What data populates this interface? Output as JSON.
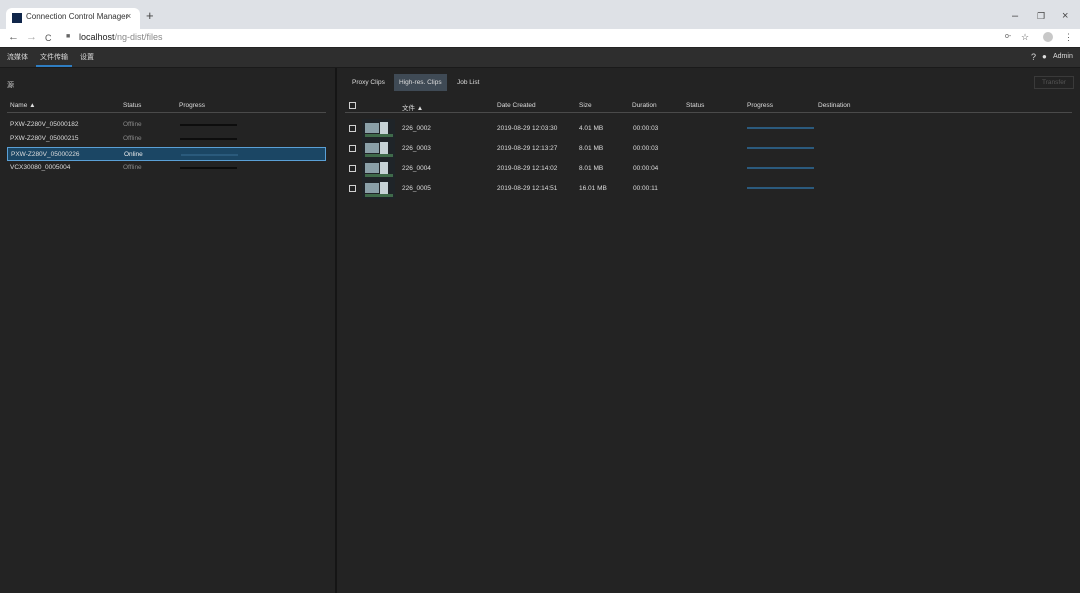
{
  "browser": {
    "tab_title": "Connection Control Manager",
    "tab_close": "×",
    "new_tab": "+",
    "url_host": "localhost",
    "url_path": "/ng-dist/files",
    "nav_back": "←",
    "nav_forward": "→",
    "nav_reload": "C",
    "window_minimize": "–",
    "window_restore": "❐",
    "window_close": "×",
    "key_icon": "o-",
    "star_icon": "☆",
    "menu_icon": "⋮"
  },
  "app_nav": {
    "tabs": [
      "流媒体",
      "文件传输",
      "设置"
    ],
    "active_tab": "文件传输",
    "help": "?",
    "user": "Admin"
  },
  "devices": {
    "title": "源",
    "columns": {
      "name": "Name ▲",
      "status": "Status",
      "progress": "Progress"
    },
    "rows": [
      {
        "name": "PXW-Z280V_05000182",
        "status": "Offline",
        "selected": false
      },
      {
        "name": "PXW-Z280V_05000215",
        "status": "Offline",
        "selected": false
      },
      {
        "name": "PXW-Z280V_05000226",
        "status": "Online",
        "selected": true
      },
      {
        "name": "VCX30080_0005004",
        "status": "Offline",
        "selected": false
      }
    ]
  },
  "clips": {
    "tabs": [
      "Proxy Clips",
      "High-res. Clips",
      "Job List"
    ],
    "active_tab": "High-res. Clips",
    "transfer_label": "Transfer",
    "columns": {
      "file": "文件 ▲",
      "date": "Date Created",
      "size": "Size",
      "duration": "Duration",
      "status": "Status",
      "progress": "Progress",
      "destination": "Destination"
    },
    "rows": [
      {
        "file": "226_0002",
        "date": "2019-08-29 12:03:30",
        "size": "4.01 MB",
        "duration": "00:00:03",
        "status": "",
        "destination": ""
      },
      {
        "file": "226_0003",
        "date": "2019-08-29 12:13:27",
        "size": "8.01 MB",
        "duration": "00:00:03",
        "status": "",
        "destination": ""
      },
      {
        "file": "226_0004",
        "date": "2019-08-29 12:14:02",
        "size": "8.01 MB",
        "duration": "00:00:04",
        "status": "",
        "destination": ""
      },
      {
        "file": "226_0005",
        "date": "2019-08-29 12:14:51",
        "size": "16.01 MB",
        "duration": "00:00:11",
        "status": "",
        "destination": ""
      }
    ]
  },
  "colors": {
    "accent": "#2f7dc1",
    "background": "#232323",
    "selection": "#1b4664"
  }
}
